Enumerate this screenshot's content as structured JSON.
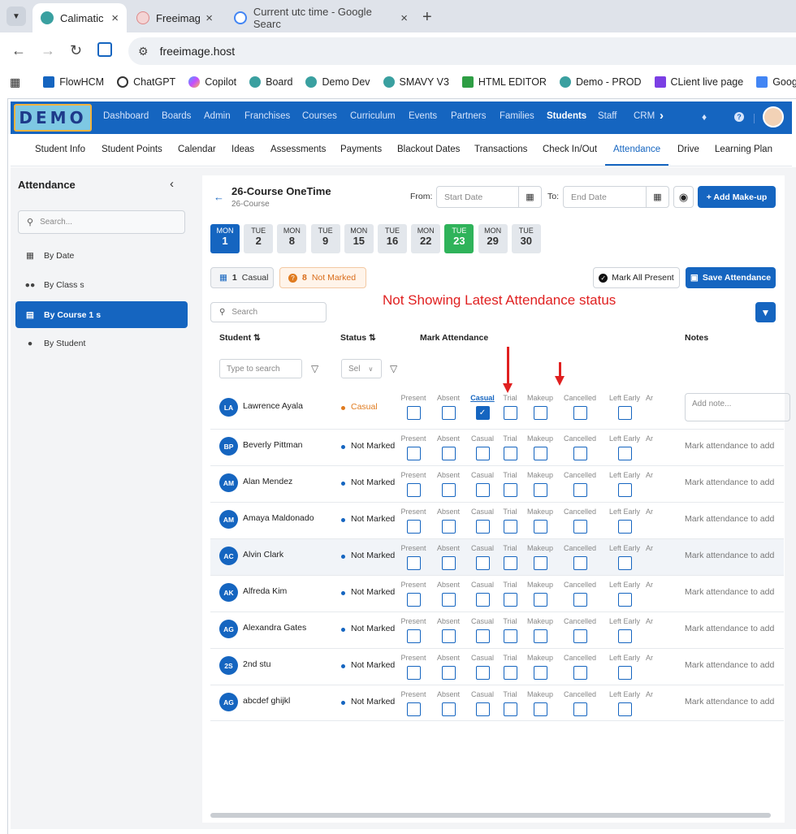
{
  "browser": {
    "tabs": [
      {
        "title": "Calimatic",
        "active": true
      },
      {
        "title": "Freeimag",
        "active": false
      },
      {
        "title": "Current utc time - Google Searc",
        "active": false
      }
    ],
    "url": "freeimage.host",
    "bookmarks": [
      "FlowHCM",
      "ChatGPT",
      "Copilot",
      "Board",
      "Demo Dev",
      "SMAVY V3",
      "HTML EDITOR",
      "Demo - PROD",
      "CLient live page",
      "Google"
    ]
  },
  "app": {
    "logo": "DEMO",
    "topnav": [
      "Dashboard",
      "Boards",
      "Admin",
      "Franchises",
      "Courses",
      "Curriculum",
      "Events",
      "Partners",
      "Families",
      "Students",
      "Staff",
      "CRM"
    ],
    "topnav_active": "Students",
    "subnav": [
      "Student Info",
      "Student Points",
      "Calendar",
      "Ideas",
      "Assessments",
      "Payments",
      "Blackout Dates",
      "Transactions",
      "Check In/Out",
      "Attendance",
      "Drive",
      "Learning Plan"
    ],
    "subnav_active": "Attendance"
  },
  "sidebar": {
    "title": "Attendance",
    "search_placeholder": "Search...",
    "items": [
      {
        "label": "By Date",
        "icon": "calendar-icon"
      },
      {
        "label": "By Class s",
        "icon": "users-icon"
      },
      {
        "label": "By Course 1 s",
        "icon": "book-icon",
        "active": true
      },
      {
        "label": "By Student",
        "icon": "user-icon"
      }
    ]
  },
  "course": {
    "title": "26-Course OneTime",
    "subtitle": "26-Course",
    "from_label": "From:",
    "to_label": "To:",
    "start_placeholder": "Start Date",
    "end_placeholder": "End Date",
    "add_makeup": "+ Add Make-up"
  },
  "days": [
    {
      "dow": "MON",
      "num": "1",
      "state": "selected"
    },
    {
      "dow": "TUE",
      "num": "2"
    },
    {
      "dow": "MON",
      "num": "8"
    },
    {
      "dow": "TUE",
      "num": "9"
    },
    {
      "dow": "MON",
      "num": "15"
    },
    {
      "dow": "TUE",
      "num": "16"
    },
    {
      "dow": "MON",
      "num": "22"
    },
    {
      "dow": "TUE",
      "num": "23",
      "state": "today"
    },
    {
      "dow": "MON",
      "num": "29"
    },
    {
      "dow": "TUE",
      "num": "30"
    }
  ],
  "summary": {
    "casual_count": "1",
    "casual_label": "Casual",
    "notmarked_count": "8",
    "notmarked_label": "Not Marked",
    "mark_all": "Mark All Present",
    "save": "Save Attendance"
  },
  "annotation": "Not Showing Latest Attendance status",
  "table": {
    "search_placeholder": "Search",
    "headers": {
      "student": "Student",
      "status": "Status",
      "mark": "Mark Attendance",
      "notes": "Notes"
    },
    "student_filter_placeholder": "Type to search",
    "status_filter_value": "Sel",
    "options": [
      "Present",
      "Absent",
      "Casual",
      "Trial",
      "Makeup",
      "Cancelled",
      "Left Early",
      "Ar"
    ],
    "note_placeholder": "Add note...",
    "note_hint": "Mark attendance to add",
    "rows": [
      {
        "initials": "LA",
        "name": "Lawrence Ayala",
        "status": "Casual",
        "checked": "Casual"
      },
      {
        "initials": "BP",
        "name": "Beverly Pittman",
        "status": "Not Marked"
      },
      {
        "initials": "AM",
        "name": "Alan Mendez",
        "status": "Not Marked"
      },
      {
        "initials": "AM",
        "name": "Amaya Maldonado",
        "status": "Not Marked"
      },
      {
        "initials": "AC",
        "name": "Alvin Clark",
        "status": "Not Marked",
        "highlight": true
      },
      {
        "initials": "AK",
        "name": "Alfreda Kim",
        "status": "Not Marked"
      },
      {
        "initials": "AG",
        "name": "Alexandra Gates",
        "status": "Not Marked"
      },
      {
        "initials": "2S",
        "name": "2nd stu",
        "status": "Not Marked"
      },
      {
        "initials": "AG",
        "name": "abcdef ghijkl",
        "status": "Not Marked"
      }
    ]
  },
  "colors": {
    "primary": "#1565c0",
    "today": "#2fb35a",
    "casual": "#e07b1f",
    "annotation": "#e02020"
  }
}
